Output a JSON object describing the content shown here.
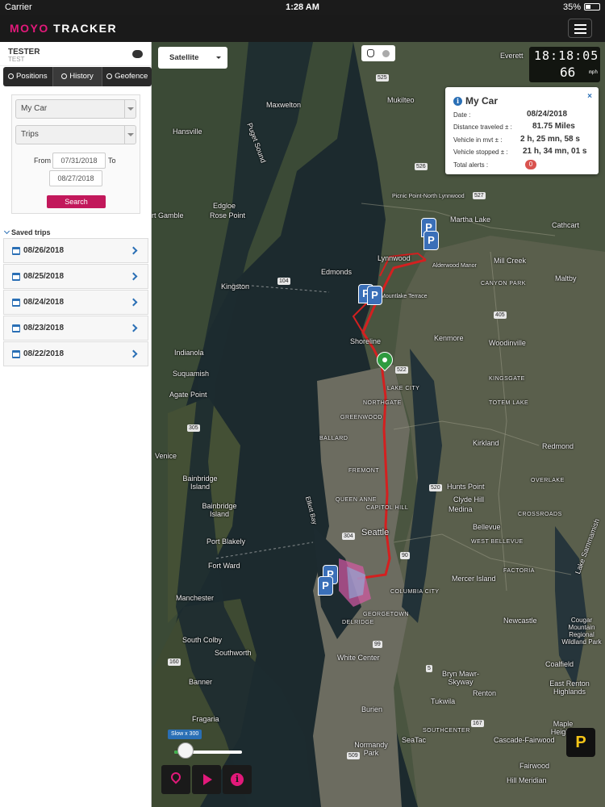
{
  "status_bar": {
    "carrier": "Carrier",
    "time": "1:28 AM",
    "battery": "35%"
  },
  "header": {
    "logo_prefix": "MOYO",
    "logo_suffix": " TRACKER"
  },
  "user": {
    "name": "TESTER",
    "subtitle": "TEST"
  },
  "tabs": [
    {
      "label": "Positions"
    },
    {
      "label": "History"
    },
    {
      "label": "Geofence"
    }
  ],
  "filters": {
    "vehicle": "My Car",
    "mode": "Trips",
    "from_label": "From",
    "from_date": "07/31/2018",
    "to_label": "To",
    "to_date": "08/27/2018",
    "search_label": "Search"
  },
  "saved_trips": {
    "heading": "Saved trips",
    "items": [
      "08/26/2018",
      "08/25/2018",
      "08/24/2018",
      "08/23/2018",
      "08/22/2018"
    ]
  },
  "map": {
    "layer": "Satellite",
    "clock_time": "18:18:05",
    "speed": "66",
    "speed_unit": "mph",
    "labels": {
      "everett": "Everett",
      "mukilteo": "Mukilteo",
      "maxwelton": "Maxwelton",
      "hansville": "Hansville",
      "puget": "Puget Sound",
      "gamble": "rt Gamble",
      "edgloe": "Edgloe",
      "rose": "Rose Point",
      "edmonds": "Edmonds",
      "lynnwood": "Lynnwood",
      "kingston": "Kingston",
      "martha": "Martha Lake",
      "mill": "Mill Creek",
      "canyon": "CANYON PARK",
      "shoreline": "Shoreline",
      "kenmore": "Kenmore",
      "woodinville": "Woodinville",
      "indianola": "Indianola",
      "suquamish": "Suquamish",
      "agate": "Agate Point",
      "lakecity": "LAKE CITY",
      "northgate": "NORTHGATE",
      "greenwood": "GREENWOOD",
      "kingsgate": "KINGSGATE",
      "totem": "TOTEM LAKE",
      "ballard": "BALLARD",
      "kirkland": "Kirkland",
      "redmond": "Redmond",
      "venice": "Venice",
      "fremont": "FREMONT",
      "bainbridge": "Bainbridge Island",
      "bainbridge2": "Bainbridge Island",
      "queenanne": "QUEEN ANNE",
      "capitol": "CAPITOL HILL",
      "hunts": "Hunts Point",
      "clyde": "Clyde Hill",
      "medina": "Medina",
      "crossroads": "CROSSROADS",
      "seattle": "Seattle",
      "bellevue": "Bellevue",
      "westbellevue": "WEST BELLEVUE",
      "portblakely": "Port Blakely",
      "fortward": "Fort Ward",
      "factoria": "FACTORIA",
      "mercer": "Mercer Island",
      "columbia": "COLUMBIA CITY",
      "manchester": "Manchester",
      "georgetown": "GEORGETOWN",
      "delridge": "DELRIDGE",
      "southcolby": "South Colby",
      "southworth": "Southworth",
      "newcastle": "Newcastle",
      "cougar": "Cougar Mountain Regional Wildland Park",
      "whitecenter": "White Center",
      "bryn": "Bryn Mawr-Skyway",
      "coalfield": "Coalfield",
      "banner": "Banner",
      "renton": "Renton",
      "eastrenton": "East Renton Highlands",
      "fragaria": "Fragaria",
      "burien": "Burien",
      "tukwila": "Tukwila",
      "normandy": "Normandy Park",
      "seatac": "SeaTac",
      "southcenter": "SOUTHCENTER",
      "cascade": "Cascade-Fairwood",
      "maple": "Maple Heights",
      "fairwood": "Fairwood",
      "hillmeridian": "Hill Meridian",
      "sammamish": "Lake Sammamish",
      "elliott": "Elliott Bay",
      "cathcart": "Cathcart",
      "maltby": "Maltby",
      "picnic": "Picnic Point-North Lynnwood",
      "mountlake": "Mountlake Terrace",
      "alderwood": "Alderwood Manor",
      "overlake": "OVERLAKE"
    },
    "shields": [
      "525",
      "526",
      "527",
      "104",
      "405",
      "522",
      "520",
      "305",
      "304",
      "90",
      "99",
      "509",
      "167",
      "160",
      "5"
    ]
  },
  "popup": {
    "title": "My Car",
    "close": "×",
    "rows": [
      {
        "label": "Date :",
        "value": "08/24/2018"
      },
      {
        "label": "Distance traveled  ± :",
        "value": "81.75 Miles"
      },
      {
        "label": "Vehicle in mvt  ± :",
        "value": "2 h, 25 mn, 58 s"
      },
      {
        "label": "Vehicle stopped ± :",
        "value": "21 h, 34 mn, 01 s"
      },
      {
        "label": "Total alerts :",
        "value": "0"
      }
    ]
  },
  "playback": {
    "speed_label": "Slow x 300",
    "speed_fraction": 0.1
  },
  "markers": {
    "parking": "P"
  },
  "colors": {
    "brand": "#e2197a",
    "route": "#d32020",
    "accent": "#2a6fb5"
  }
}
